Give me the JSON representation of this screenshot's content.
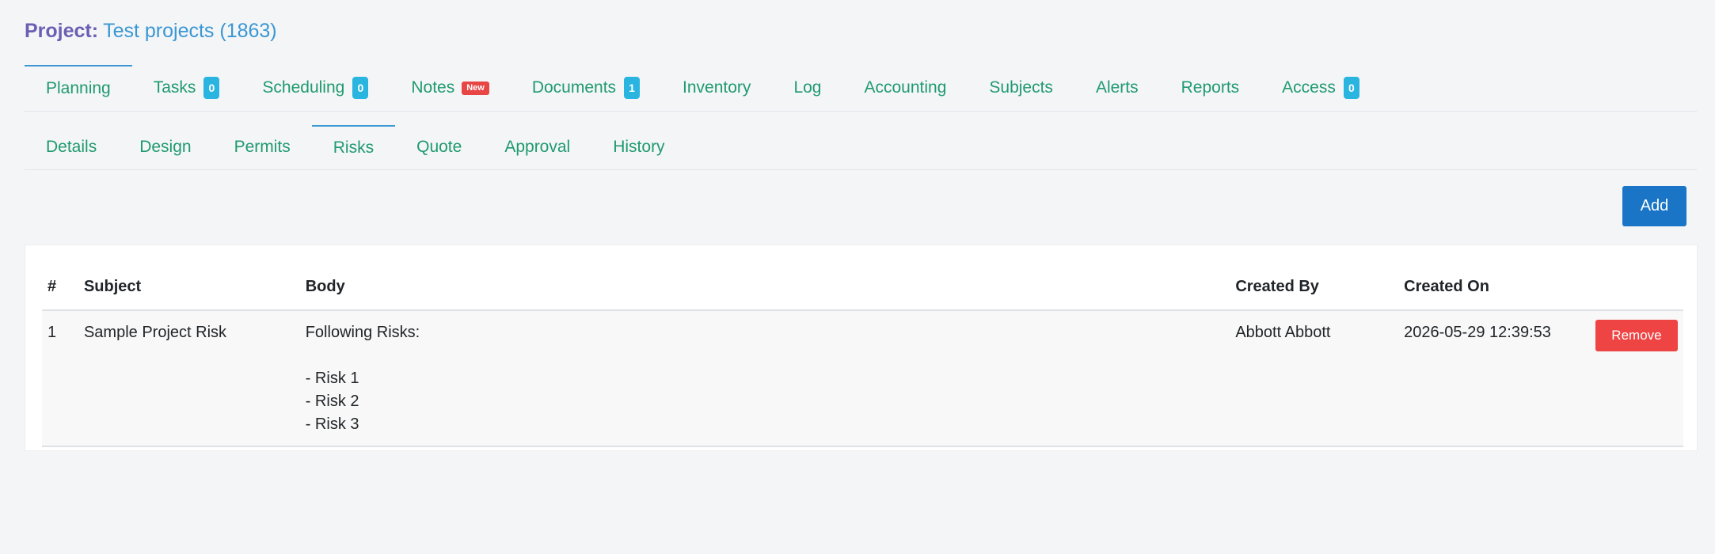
{
  "header": {
    "label": "Project:",
    "project_name": "Test projects (1863)"
  },
  "primary_tabs": [
    {
      "label": "Planning",
      "active": true
    },
    {
      "label": "Tasks",
      "badge": "0"
    },
    {
      "label": "Scheduling",
      "badge": "0"
    },
    {
      "label": "Notes",
      "badge_new": "New"
    },
    {
      "label": "Documents",
      "badge": "1"
    },
    {
      "label": "Inventory"
    },
    {
      "label": "Log"
    },
    {
      "label": "Accounting"
    },
    {
      "label": "Subjects"
    },
    {
      "label": "Alerts"
    },
    {
      "label": "Reports"
    },
    {
      "label": "Access",
      "badge": "0"
    }
  ],
  "secondary_tabs": [
    {
      "label": "Details"
    },
    {
      "label": "Design"
    },
    {
      "label": "Permits"
    },
    {
      "label": "Risks",
      "active": true
    },
    {
      "label": "Quote"
    },
    {
      "label": "Approval"
    },
    {
      "label": "History"
    }
  ],
  "toolbar": {
    "add_label": "Add"
  },
  "table": {
    "columns": [
      "#",
      "Subject",
      "Body",
      "Created By",
      "Created On",
      ""
    ],
    "rows": [
      {
        "num": "1",
        "subject": "Sample Project Risk",
        "body": "Following Risks:\n\n- Risk 1\n- Risk 2\n- Risk 3",
        "created_by": "Abbott Abbott",
        "created_on": "2026-05-29 12:39:53",
        "remove_label": "Remove"
      }
    ]
  },
  "colors": {
    "accent": "#1a75c6",
    "tab_text": "#1f9a6e",
    "badge": "#29b5e0",
    "danger": "#ef4444",
    "title_label": "#6b5fb3",
    "title_name": "#3a97d4"
  }
}
